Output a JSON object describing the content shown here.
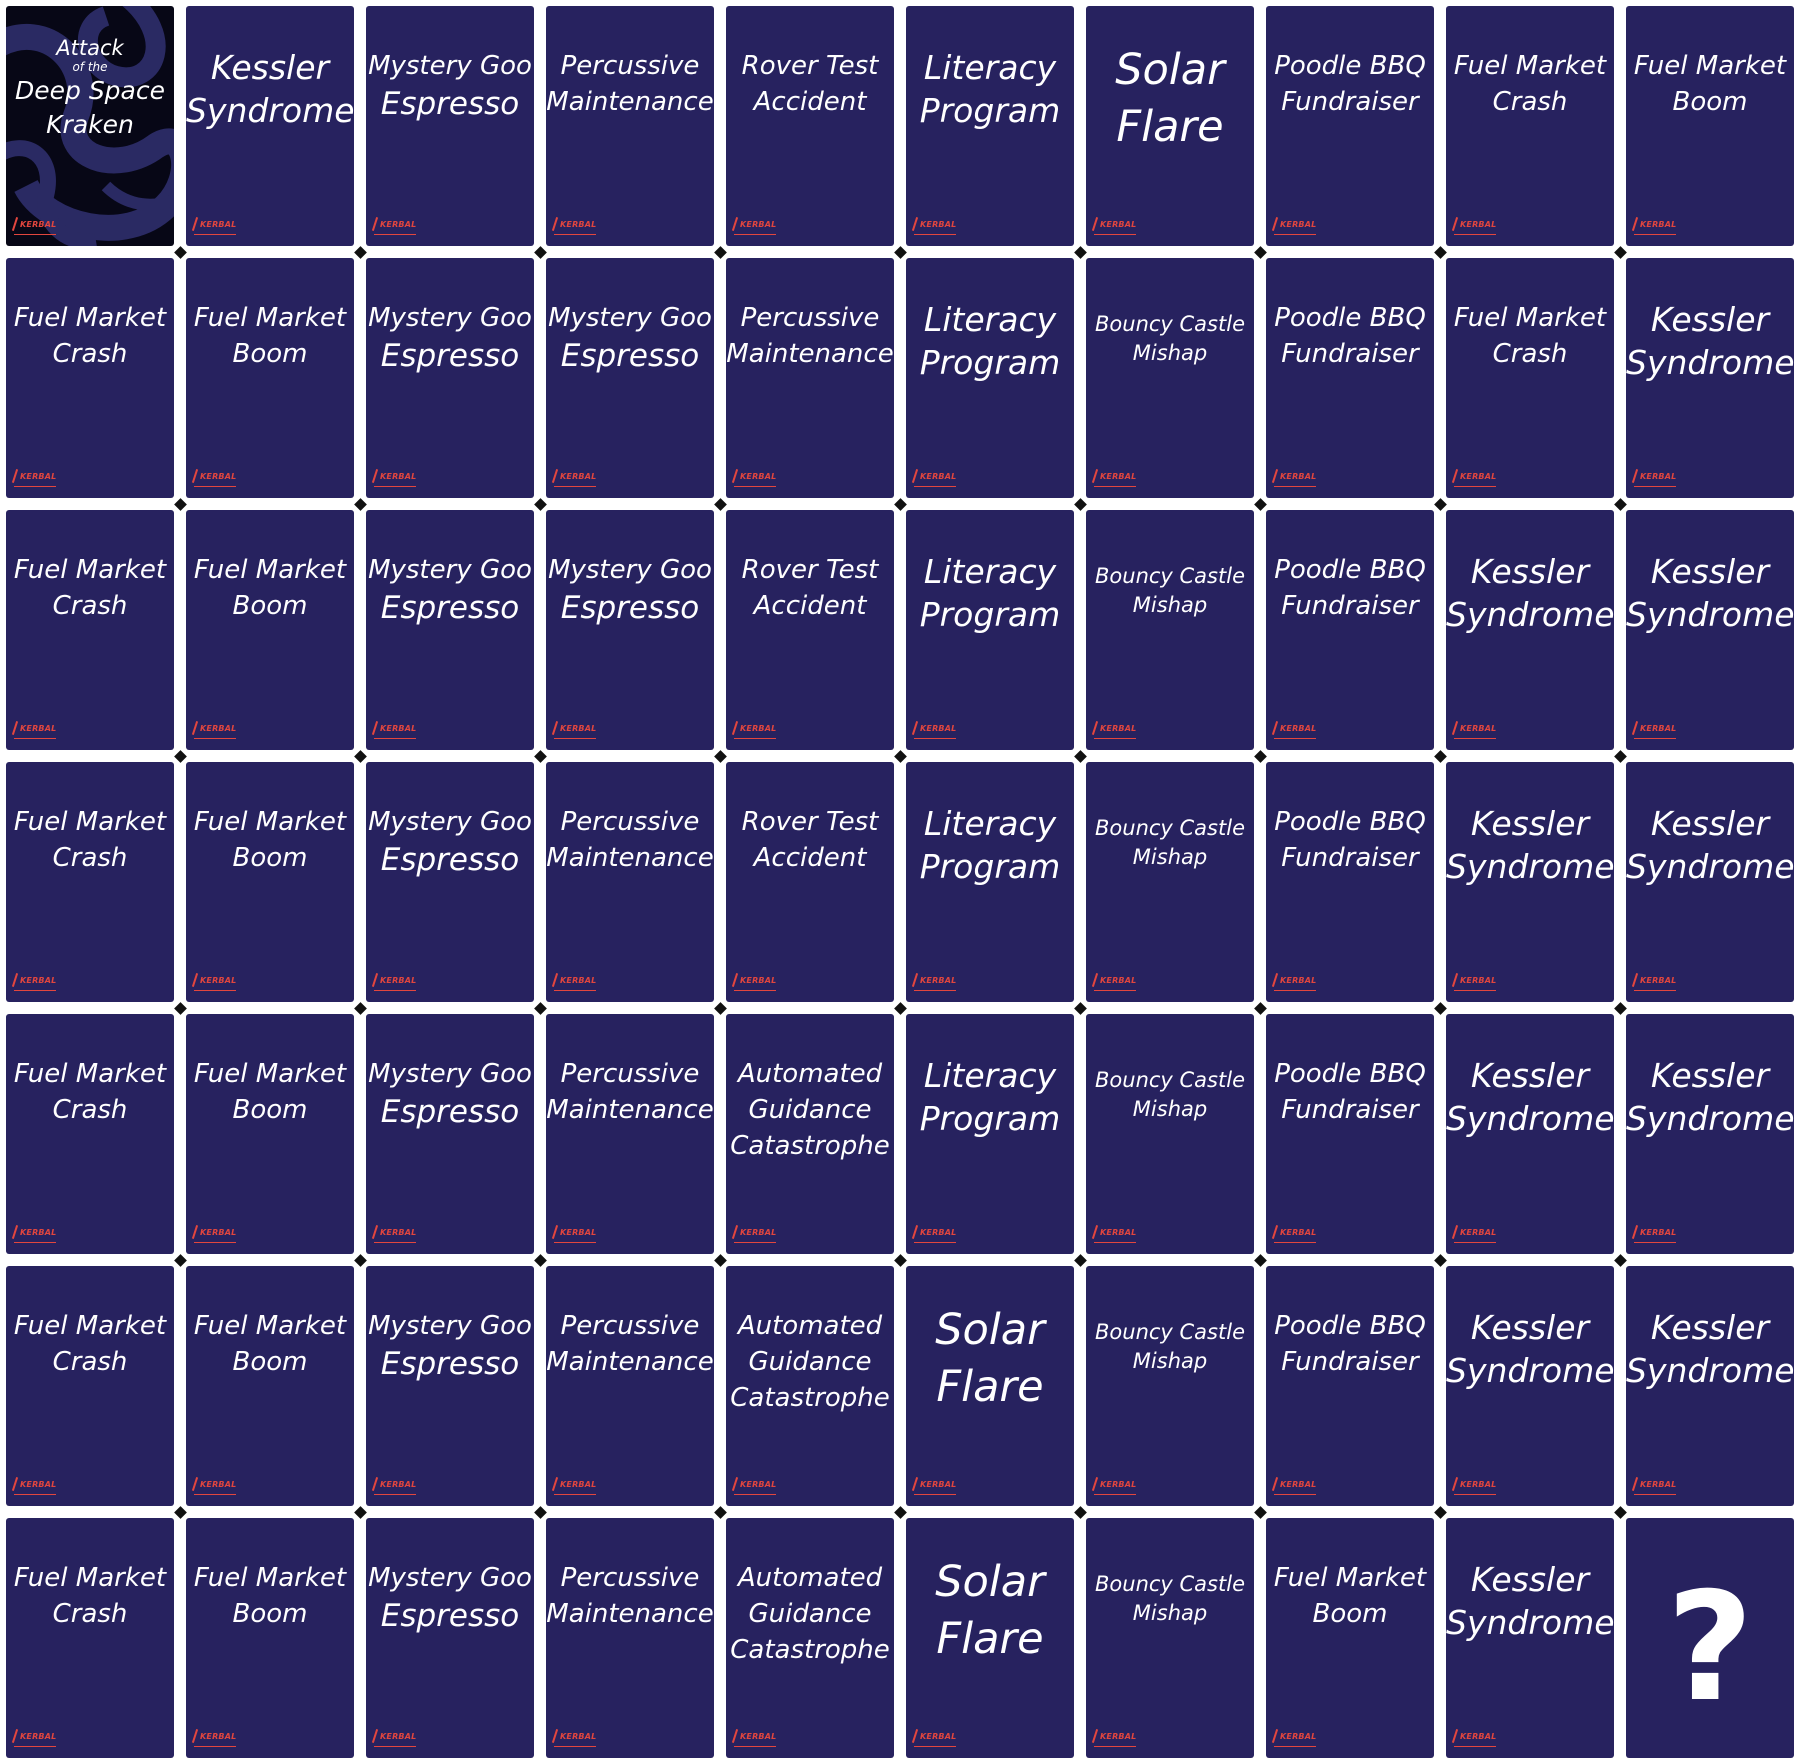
{
  "special_card": {
    "title_line1": "Attack",
    "title_line2": "of the",
    "title_line3": "Deep Space",
    "title_line4": "Kraken"
  },
  "logo_text": "KERBAL",
  "mystery_card": {
    "symbol": "?"
  },
  "colors": {
    "card": "#27225f",
    "logo": "#e2463e",
    "background": "#ffffff"
  },
  "rows": [
    [
      {
        "type": "special"
      },
      {
        "title": "Kessler\nSyndrome",
        "size": "large"
      },
      {
        "title": "Mystery Goo\nEspresso",
        "size": "mixed"
      },
      {
        "title": "Percussive\nMaintenance",
        "size": "normal"
      },
      {
        "title": "Rover Test\nAccident",
        "size": "normal"
      },
      {
        "title": "Literacy\nProgram",
        "size": "large"
      },
      {
        "title": "Solar\nFlare",
        "size": "xlarge"
      },
      {
        "title": "Poodle BBQ\nFundraiser",
        "size": "normal"
      },
      {
        "title": "Fuel Market\nCrash",
        "size": "normal"
      },
      {
        "title": "Fuel Market\nBoom",
        "size": "normal"
      }
    ],
    [
      {
        "title": "Fuel Market\nCrash",
        "size": "normal"
      },
      {
        "title": "Fuel Market\nBoom",
        "size": "normal"
      },
      {
        "title": "Mystery Goo\nEspresso",
        "size": "mixed"
      },
      {
        "title": "Mystery Goo\nEspresso",
        "size": "mixed"
      },
      {
        "title": "Percussive\nMaintenance",
        "size": "normal"
      },
      {
        "title": "Literacy\nProgram",
        "size": "large"
      },
      {
        "title": "Bouncy Castle\nMishap",
        "size": "small"
      },
      {
        "title": "Poodle BBQ\nFundraiser",
        "size": "normal"
      },
      {
        "title": "Fuel Market\nCrash",
        "size": "normal"
      },
      {
        "title": "Kessler\nSyndrome",
        "size": "large"
      }
    ],
    [
      {
        "title": "Fuel Market\nCrash",
        "size": "normal"
      },
      {
        "title": "Fuel Market\nBoom",
        "size": "normal"
      },
      {
        "title": "Mystery Goo\nEspresso",
        "size": "mixed"
      },
      {
        "title": "Mystery Goo\nEspresso",
        "size": "mixed"
      },
      {
        "title": "Rover Test\nAccident",
        "size": "normal"
      },
      {
        "title": "Literacy\nProgram",
        "size": "large"
      },
      {
        "title": "Bouncy Castle\nMishap",
        "size": "small"
      },
      {
        "title": "Poodle BBQ\nFundraiser",
        "size": "normal"
      },
      {
        "title": "Kessler\nSyndrome",
        "size": "large"
      },
      {
        "title": "Kessler\nSyndrome",
        "size": "large"
      }
    ],
    [
      {
        "title": "Fuel Market\nCrash",
        "size": "normal"
      },
      {
        "title": "Fuel Market\nBoom",
        "size": "normal"
      },
      {
        "title": "Mystery Goo\nEspresso",
        "size": "mixed"
      },
      {
        "title": "Percussive\nMaintenance",
        "size": "normal"
      },
      {
        "title": "Rover Test\nAccident",
        "size": "normal"
      },
      {
        "title": "Literacy\nProgram",
        "size": "large"
      },
      {
        "title": "Bouncy Castle\nMishap",
        "size": "small"
      },
      {
        "title": "Poodle BBQ\nFundraiser",
        "size": "normal"
      },
      {
        "title": "Kessler\nSyndrome",
        "size": "large"
      },
      {
        "title": "Kessler\nSyndrome",
        "size": "large"
      }
    ],
    [
      {
        "title": "Fuel Market\nCrash",
        "size": "normal"
      },
      {
        "title": "Fuel Market\nBoom",
        "size": "normal"
      },
      {
        "title": "Mystery Goo\nEspresso",
        "size": "mixed"
      },
      {
        "title": "Percussive\nMaintenance",
        "size": "normal"
      },
      {
        "title": "Automated\nGuidance\nCatastrophe",
        "size": "normal"
      },
      {
        "title": "Literacy\nProgram",
        "size": "large"
      },
      {
        "title": "Bouncy Castle\nMishap",
        "size": "small"
      },
      {
        "title": "Poodle BBQ\nFundraiser",
        "size": "normal"
      },
      {
        "title": "Kessler\nSyndrome",
        "size": "large"
      },
      {
        "title": "Kessler\nSyndrome",
        "size": "large"
      }
    ],
    [
      {
        "title": "Fuel Market\nCrash",
        "size": "normal"
      },
      {
        "title": "Fuel Market\nBoom",
        "size": "normal"
      },
      {
        "title": "Mystery Goo\nEspresso",
        "size": "mixed"
      },
      {
        "title": "Percussive\nMaintenance",
        "size": "normal"
      },
      {
        "title": "Automated\nGuidance\nCatastrophe",
        "size": "normal"
      },
      {
        "title": "Solar\nFlare",
        "size": "xlarge"
      },
      {
        "title": "Bouncy Castle\nMishap",
        "size": "small"
      },
      {
        "title": "Poodle BBQ\nFundraiser",
        "size": "normal"
      },
      {
        "title": "Kessler\nSyndrome",
        "size": "large"
      },
      {
        "title": "Kessler\nSyndrome",
        "size": "large"
      }
    ],
    [
      {
        "title": "Fuel Market\nCrash",
        "size": "normal"
      },
      {
        "title": "Fuel Market\nBoom",
        "size": "normal"
      },
      {
        "title": "Mystery Goo\nEspresso",
        "size": "mixed"
      },
      {
        "title": "Percussive\nMaintenance",
        "size": "normal"
      },
      {
        "title": "Automated\nGuidance\nCatastrophe",
        "size": "normal"
      },
      {
        "title": "Solar\nFlare",
        "size": "xlarge"
      },
      {
        "title": "Bouncy Castle\nMishap",
        "size": "small"
      },
      {
        "title": "Fuel Market\nBoom",
        "size": "normal"
      },
      {
        "title": "Kessler\nSyndrome",
        "size": "large"
      },
      {
        "type": "mystery"
      }
    ]
  ]
}
